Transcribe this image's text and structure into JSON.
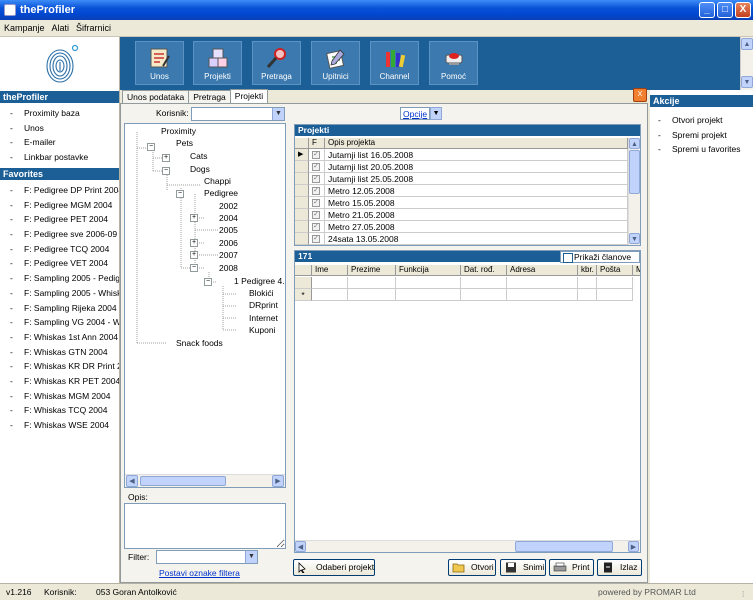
{
  "window": {
    "title": "theProfiler",
    "min": "_",
    "max": "□",
    "close": "X"
  },
  "menu": [
    "Kampanje",
    "Alati",
    "Šifrarnici"
  ],
  "left": {
    "section1": "theProfiler",
    "items1": [
      "Proximity baza",
      "Unos",
      "E-mailer",
      "Linkbar postavke"
    ],
    "section2": "Favorites",
    "favorites": [
      "F: Pedigree DP Print 2004",
      "F: Pedigree MGM 2004",
      "F: Pedigree PET 2004",
      "F: Pedigree sve 2006-09",
      "F: Pedigree TCQ 2004",
      "F: Pedigree VET 2004",
      "F: Sampling 2005 - Pedigr",
      "F: Sampling 2005 - Whiska",
      "F: Sampling Rijeka 2004 -",
      "F: Sampling VG 2004 - Wh",
      "F: Whiskas 1st Ann 2004",
      "F: Whiskas GTN 2004",
      "F: Whiskas KR DR Print 20",
      "F: Whiskas KR PET 2004",
      "F: Whiskas MGM 2004",
      "F: Whiskas TCQ 2004",
      "F: Whiskas WSE 2004"
    ]
  },
  "toolbar": [
    {
      "label": "Unos",
      "icon": "entry-form-icon"
    },
    {
      "label": "Projekti",
      "icon": "projects-cubes-icon"
    },
    {
      "label": "Pretraga",
      "icon": "search-magnifier-icon"
    },
    {
      "label": "Upitnici",
      "icon": "questionnaire-icon"
    },
    {
      "label": "Channel",
      "icon": "channel-books-icon"
    },
    {
      "label": "Pomoć",
      "icon": "help-icon"
    }
  ],
  "tabs": [
    "Unos podataka",
    "Pretraga",
    "Projekti"
  ],
  "korisnik_label": "Korisnik:",
  "korisnik_value": "",
  "tree": {
    "root": "Proximity",
    "pets": "Pets",
    "cats": "Cats",
    "dogs": "Dogs",
    "chappi": "Chappi",
    "pedigree": "Pedigree",
    "years": [
      "2002",
      "2004",
      "2005",
      "2006",
      "2007",
      "2008"
    ],
    "p2008child": "1 Pedigree 4.",
    "leaves": [
      "Blokići",
      "DRprint",
      "Internet",
      "Kuponi"
    ],
    "snack": "Snack foods",
    "plus": "+",
    "minus": "−"
  },
  "opis_label": "Opis:",
  "filter_label": "Filter:",
  "filter_link": "Postavi oznake filtera",
  "opcije": "Opcije",
  "projects": {
    "header": "Projekti",
    "col_f": "F",
    "col_opis": "Opis projekta",
    "rows": [
      "Jutarnji list 16.05.2008",
      "Jutarnji list 20.05.2008",
      "Jutarnji list 25.05.2008",
      "Metro 12.05.2008",
      "Metro 15.05.2008",
      "Metro 21.05.2008",
      "Metro 27.05.2008",
      "24sata 13.05.2008"
    ],
    "check": "✓",
    "current_marker": "▶"
  },
  "members": {
    "count": "171",
    "show_members": "Prikaži članove",
    "columns": [
      "Ime",
      "Prezime",
      "Funkcija",
      "Dat. rođ.",
      "Adresa",
      "kbr.",
      "Pošta",
      "M"
    ],
    "new_row_marker": "*"
  },
  "buttons": {
    "select": "Odaberi projekt",
    "open": "Otvori",
    "save": "Snimi",
    "print": "Print",
    "exit": "Izlaz"
  },
  "right": {
    "header": "Akcije",
    "items": [
      "Otvori projekt",
      "Spremi projekt",
      "Spremi u favorites"
    ],
    "close": "X"
  },
  "status": {
    "version": "v1.216",
    "user_label": "Korisnik:",
    "user": "053 Goran Antolković",
    "powered": "powered by PROMAR Ltd"
  },
  "scroll": {
    "up": "▲",
    "down": "▼",
    "left": "◀",
    "right": "▶",
    "grip": "⁞"
  },
  "colors": {
    "header_blue": "#1c5e96",
    "titlebar": "#0a53d8",
    "link": "#0033cc"
  }
}
